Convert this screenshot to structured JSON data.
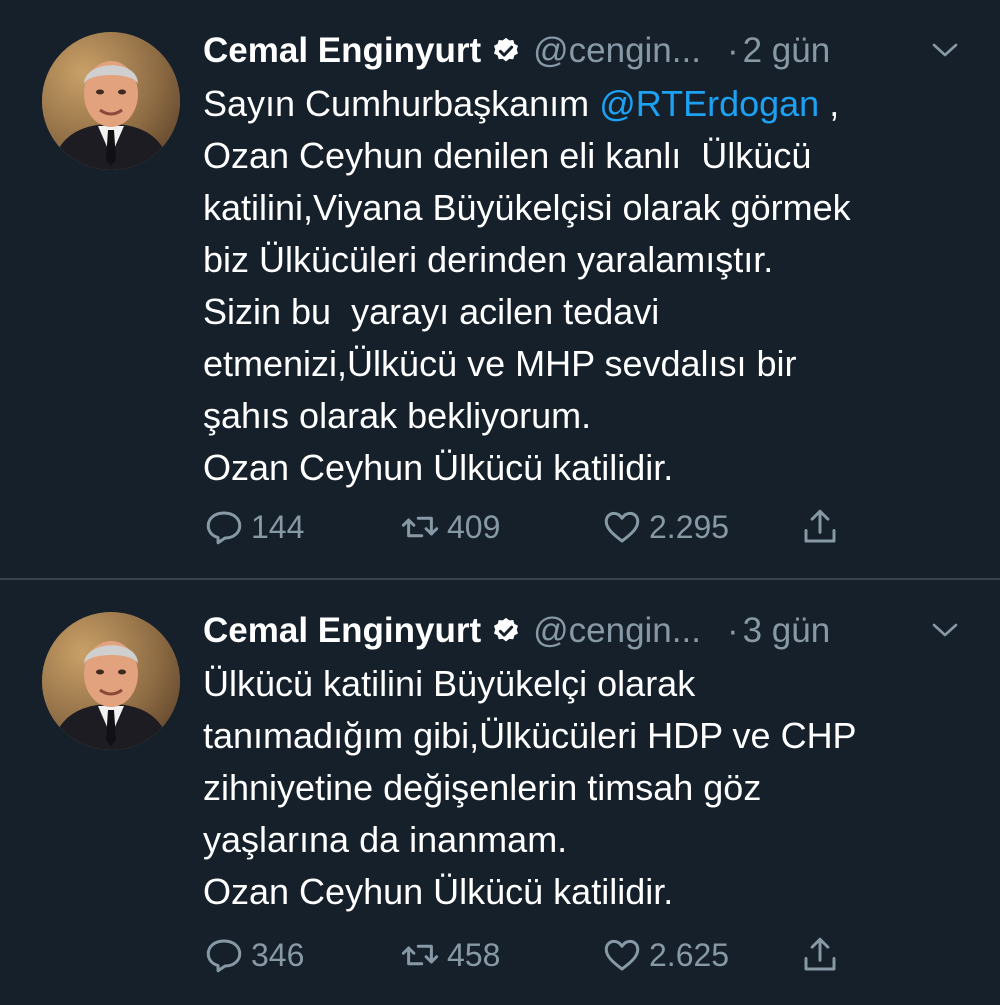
{
  "colors": {
    "background": "#15202b",
    "text": "#ffffff",
    "muted": "#8899a6",
    "link": "#1da1f2",
    "divider": "#38444d"
  },
  "tweets": [
    {
      "author_name": "Cemal Enginyurt",
      "handle": "@cengin...",
      "dot": "·",
      "time": "2 gün",
      "verified_icon": "verified-badge-icon",
      "lines": [
        {
          "pre": "Sayın Cumhurbaşkanım ",
          "mention": "@RTErdogan",
          "post": " ,"
        },
        {
          "text": "Ozan Ceyhun denilen eli kanlı  Ülkücü"
        },
        {
          "text": "katilini,Viyana Büyükelçisi olarak görmek"
        },
        {
          "text": "biz Ülkücüleri derinden yaralamıştır."
        },
        {
          "text": "Sizin bu  yarayı acilen tedavi"
        },
        {
          "text": "etmenizi,Ülkücü ve MHP sevdalısı bir"
        },
        {
          "text": "şahıs olarak bekliyorum."
        },
        {
          "text": "Ozan Ceyhun Ülkücü katilidir."
        }
      ],
      "replies": "144",
      "retweets": "409",
      "likes": "2.295"
    },
    {
      "author_name": "Cemal Enginyurt",
      "handle": "@cengin...",
      "dot": "·",
      "time": "3 gün",
      "verified_icon": "verified-badge-icon",
      "lines": [
        {
          "text": "Ülkücü katilini Büyükelçi olarak"
        },
        {
          "text": "tanımadığım gibi,Ülkücüleri HDP ve CHP"
        },
        {
          "text": "zihniyetine değişenlerin timsah göz"
        },
        {
          "text": "yaşlarına da inanmam."
        },
        {
          "text": "Ozan Ceyhun Ülkücü katilidir."
        }
      ],
      "replies": "346",
      "retweets": "458",
      "likes": "2.625"
    }
  ]
}
